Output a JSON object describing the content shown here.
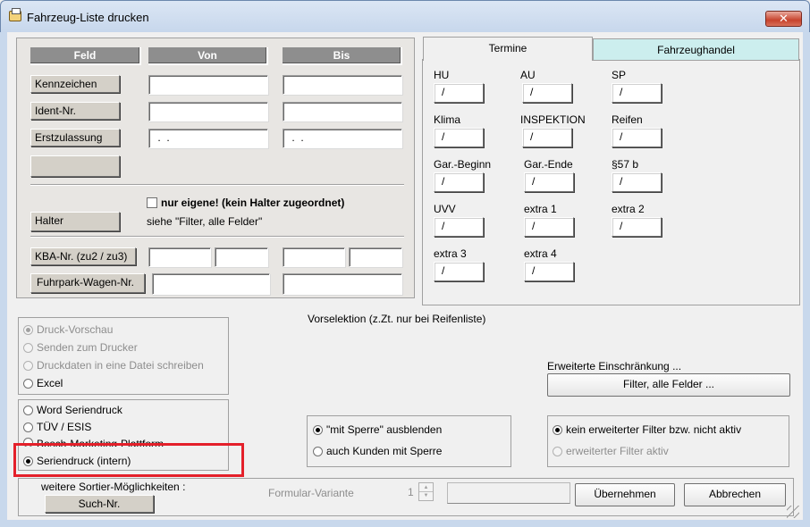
{
  "window": {
    "title": "Fahrzeug-Liste drucken",
    "close": "✕"
  },
  "left": {
    "headers": {
      "feld": "Feld",
      "von": "Von",
      "bis": "Bis"
    },
    "rows": [
      {
        "label": "Kennzeichen",
        "von": "",
        "bis": ""
      },
      {
        "label": "Ident-Nr.",
        "von": "",
        "bis": ""
      },
      {
        "label": "Erstzulassung",
        "von": " .  .",
        "bis": " .  ."
      }
    ],
    "empty_button": "",
    "nur_eigene": "nur eigene! (kein Halter zugeordnet)",
    "halter": "Halter",
    "siehe_filter": "siehe \"Filter, alle Felder\"",
    "kba": "KBA-Nr. (zu2 / zu3)",
    "fuhrpark": "Fuhrpark-Wagen-Nr."
  },
  "tabs": {
    "termine": "Termine",
    "fahrzeughandel": "Fahrzeughandel"
  },
  "dates": [
    {
      "label": "HU",
      "value": "/"
    },
    {
      "label": "AU",
      "value": "/"
    },
    {
      "label": "SP",
      "value": "/"
    },
    {
      "label": "Klima",
      "value": "/"
    },
    {
      "label": "INSPEKTION",
      "value": "/"
    },
    {
      "label": "Reifen",
      "value": "/"
    },
    {
      "label": "Gar.-Beginn",
      "value": "/"
    },
    {
      "label": "Gar.-Ende",
      "value": "/"
    },
    {
      "label": "§57 b",
      "value": "/"
    },
    {
      "label": "UVV",
      "value": "/"
    },
    {
      "label": "extra 1",
      "value": "/"
    },
    {
      "label": "extra 2",
      "value": "/"
    },
    {
      "label": "extra 3",
      "value": "/"
    },
    {
      "label": "extra 4",
      "value": "/"
    }
  ],
  "vorselektion": "Vorselektion (z.Zt. nur bei Reifenliste)",
  "output_options": [
    {
      "label": "Druck-Vorschau",
      "selected": true,
      "enabled": false
    },
    {
      "label": "Senden zum Drucker",
      "selected": false,
      "enabled": false
    },
    {
      "label": "Druckdaten in eine Datei schreiben",
      "selected": false,
      "enabled": false
    },
    {
      "label": "Excel",
      "selected": false,
      "enabled": true
    }
  ],
  "serial_options": [
    {
      "label": "Word Seriendruck",
      "selected": false
    },
    {
      "label": "TÜV / ESIS",
      "selected": false
    },
    {
      "label": "Bosch-Marketing-Plattform",
      "selected": false
    },
    {
      "label": "Seriendruck (intern)",
      "selected": true
    }
  ],
  "sperre_options": [
    {
      "label": "\"mit Sperre\" ausblenden",
      "selected": true
    },
    {
      "label": "auch Kunden mit Sperre",
      "selected": false
    }
  ],
  "erweitert": {
    "label": "Erweiterte Einschränkung ...",
    "button": "Filter, alle Felder ...",
    "options": [
      {
        "label": "kein erweiterter Filter bzw. nicht aktiv",
        "selected": true,
        "enabled": true
      },
      {
        "label": "erweiterter Filter aktiv",
        "selected": false,
        "enabled": false
      }
    ]
  },
  "footer": {
    "sortier": "weitere Sortier-Möglichkeiten :",
    "such_nr": "Such-Nr.",
    "formular_variante": "Formular-Variante",
    "variante_value": "1",
    "uebernehmen": "Übernehmen",
    "abbrechen": "Abbrechen"
  }
}
